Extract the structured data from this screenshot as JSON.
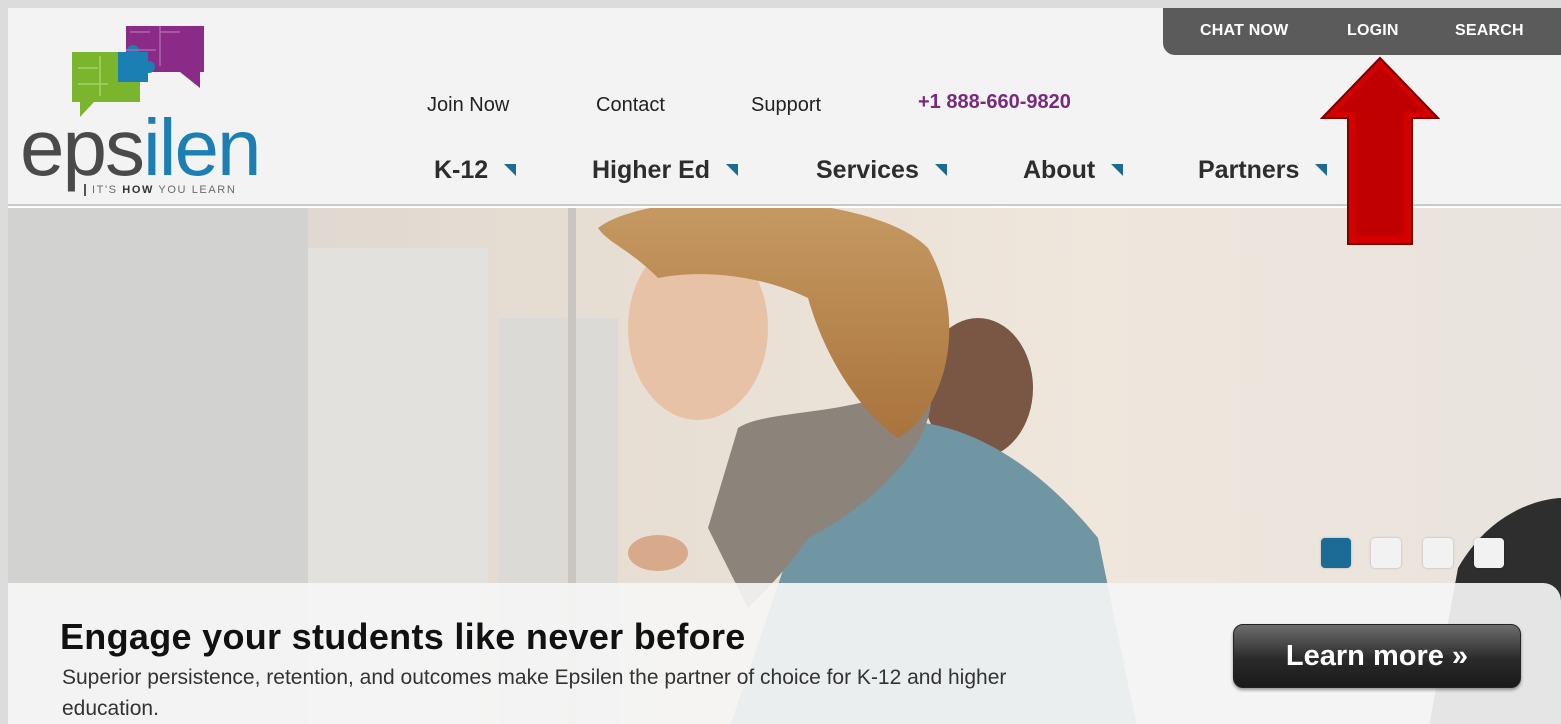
{
  "brand": {
    "logo_prefix": "eps",
    "logo_i": "i",
    "logo_suffix": "len",
    "tagline_pre": "IT'S ",
    "tagline_bold": "HOW",
    "tagline_post": " YOU LEARN"
  },
  "utility_nav": {
    "chat": "CHAT NOW",
    "login": "LOGIN",
    "search": "SEARCH"
  },
  "top_links": {
    "join": "Join Now",
    "contact": "Contact",
    "support": "Support",
    "phone": "+1 888-660-9820"
  },
  "main_nav": [
    {
      "label": "K-12"
    },
    {
      "label": "Higher Ed"
    },
    {
      "label": "Services"
    },
    {
      "label": "About"
    },
    {
      "label": "Partners"
    }
  ],
  "hero": {
    "title": "Engage your students like never before",
    "text": "Superior persistence, retention, and outcomes make Epsilen the partner of choice for K-12 and higher education.",
    "button": "Learn more »",
    "slide_count": 4,
    "active_slide": 1
  },
  "colors": {
    "brand_blue": "#1b7fb3",
    "phone_purple": "#7a2a7e",
    "arrow_red": "#d40000",
    "util_bar": "#5b5b5b"
  }
}
